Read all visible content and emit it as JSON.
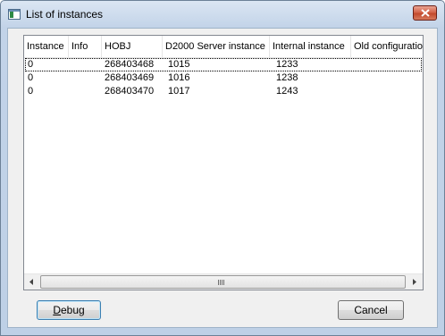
{
  "window": {
    "title": "List of instances"
  },
  "table": {
    "columns": [
      "Instance",
      "Info",
      "HOBJ",
      "D2000 Server instance",
      "Internal instance",
      "Old configuration"
    ],
    "rows": [
      {
        "instance": "0",
        "info": "",
        "hobj": "268403468",
        "server_instance": "1015",
        "internal_instance": "1233",
        "old_configuration": ""
      },
      {
        "instance": "0",
        "info": "",
        "hobj": "268403469",
        "server_instance": "1016",
        "internal_instance": "1238",
        "old_configuration": ""
      },
      {
        "instance": "0",
        "info": "",
        "hobj": "268403470",
        "server_instance": "1017",
        "internal_instance": "1243",
        "old_configuration": ""
      }
    ]
  },
  "buttons": {
    "debug_accel": "D",
    "debug_rest": "ebug",
    "cancel": "Cancel"
  },
  "icons": {
    "app": "window-app-icon",
    "close": "close-icon",
    "scroll_left": "arrow-left-icon",
    "scroll_right": "arrow-right-icon"
  }
}
